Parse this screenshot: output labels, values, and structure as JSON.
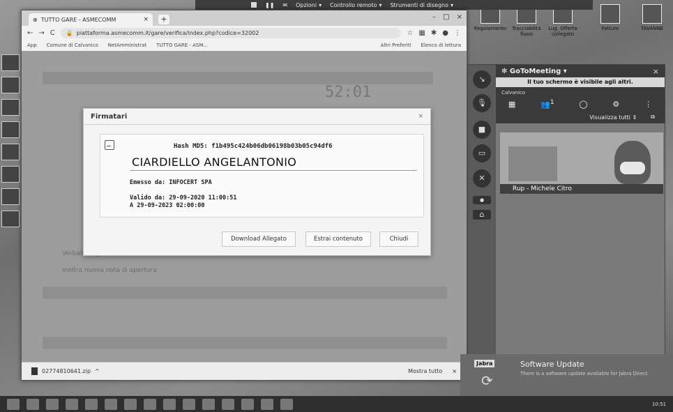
{
  "remote_bar": {
    "options": "Opzioni",
    "remote_control": "Controllo remoto",
    "drawing_tools": "Strumenti di disegno"
  },
  "desktop_top": {
    "item1": "Regolamento",
    "item2": "Tracciabilità flussi",
    "item3": "Lug. Offerta collegato",
    "item4": "Fatture",
    "item5": "TAVANNE"
  },
  "browser": {
    "tab_title": "TUTTO GARE - ASMECOMM",
    "url": "piattaforma.asmecomm.it/gare/verifica/index.php?codice=32002",
    "bookmarks": [
      "App",
      "Comune di Calvanico",
      "NetAmministrat",
      "TUTTO GARE - ASM..."
    ],
    "bookmarks_right": [
      "Altri Preferiti",
      "Elenco di lettura"
    ]
  },
  "page": {
    "clock": "52:01",
    "faint_line1": "Verbale di gara / Apertura offerte",
    "faint_line2": "Inoltra nuova nota di apertura"
  },
  "modal": {
    "title": "Firmatari",
    "close": "×",
    "hash": "Hash MD5: f1b495c424b06db06198b03b05c94df6",
    "signer": "CIARDIELLO ANGELANTONIO",
    "issuer": "Emesso da: INFOCERT SPA",
    "valid_from": "Valido da: 29-09-2020 11:00:51",
    "valid_to": "A 29-09-2023 02:00:00",
    "btn_download": "Download Allegato",
    "btn_extract": "Estrai contenuto",
    "btn_close": "Chiudi"
  },
  "download_bar": {
    "file": "02774810641.zip",
    "show_all": "Mostra tutto",
    "close": "×"
  },
  "gtm": {
    "title": "GoToMeeting",
    "share_notice": "Il tuo schermo è visibile agli altri.",
    "org": "Calvanico",
    "count": "1",
    "view_all": "Visualizza tutti",
    "video_label": "Rup - Michele Citro"
  },
  "toast": {
    "badge": "Jabra",
    "title": "Software Update",
    "body": "There is a software update available for Jabra Direct."
  },
  "taskbar": {
    "time": "10:51"
  }
}
